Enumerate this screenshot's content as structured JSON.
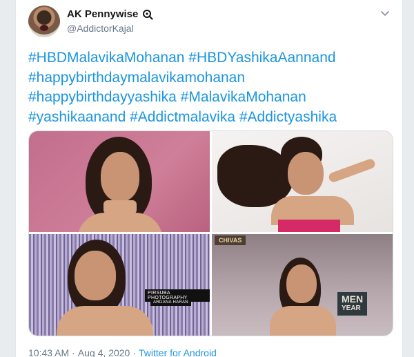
{
  "tweet": {
    "author_name": "AK Pennywise",
    "handle": "@AddictorKajal",
    "hashtag_lines": [
      [
        "#HBDMalavikaMohanan",
        "#HBDYashikaAannand"
      ],
      [
        "#happybirthdaymalavikamohanan"
      ],
      [
        "#happybirthdayyashika",
        "#MalavikaMohanan"
      ],
      [
        "#yashikaanand",
        "#Addictmalavika",
        "#Addictyashika"
      ]
    ],
    "time": "10:43 AM",
    "date": "Aug 4, 2020",
    "separator": "·",
    "source": "Twitter for Android"
  },
  "media": {
    "photo3_watermark_1": "PIRSUBA PHOTOGRAPHY",
    "photo3_watermark_2": "ARDANA HARAN",
    "photo4_sign": "CHIVAS",
    "photo4_banner_line1": "MEN",
    "photo4_banner_line2": "YEAR"
  },
  "icons": {
    "verified": "search-badge-icon",
    "more": "chevron-down-icon"
  },
  "colors": {
    "link": "#1b95e0",
    "name": "#14171a",
    "muted": "#657786"
  }
}
